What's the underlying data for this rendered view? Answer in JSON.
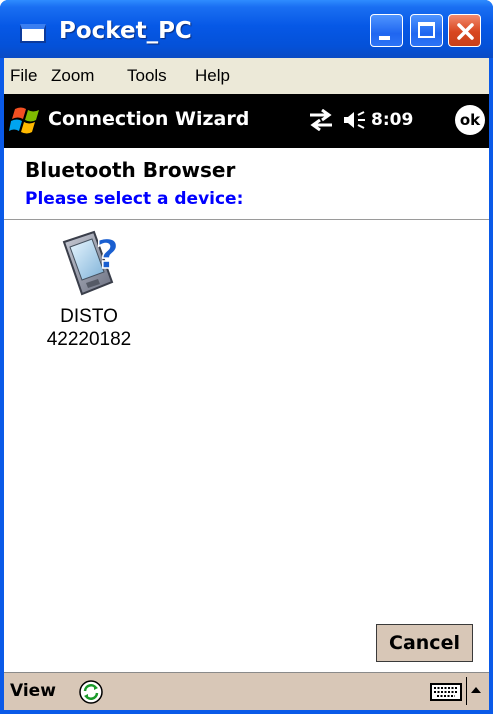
{
  "window": {
    "title": "Pocket_PC"
  },
  "menu": {
    "items": [
      "File",
      "Zoom",
      "Tools",
      "Help"
    ]
  },
  "navbar": {
    "title": "Connection Wizard",
    "time": "8:09",
    "ok_label": "ok"
  },
  "header": {
    "title": "Bluetooth Browser",
    "subtitle": "Please select a device:"
  },
  "devices": [
    {
      "name_line1": "DISTO",
      "name_line2": "42220182",
      "icon": "unknown-device-icon"
    }
  ],
  "buttons": {
    "cancel": "Cancel"
  },
  "command_bar": {
    "view_label": "View"
  },
  "colors": {
    "titlebar": "#0658e6",
    "accent_text": "#0000ff",
    "command_bar": "#d8c7b7"
  }
}
